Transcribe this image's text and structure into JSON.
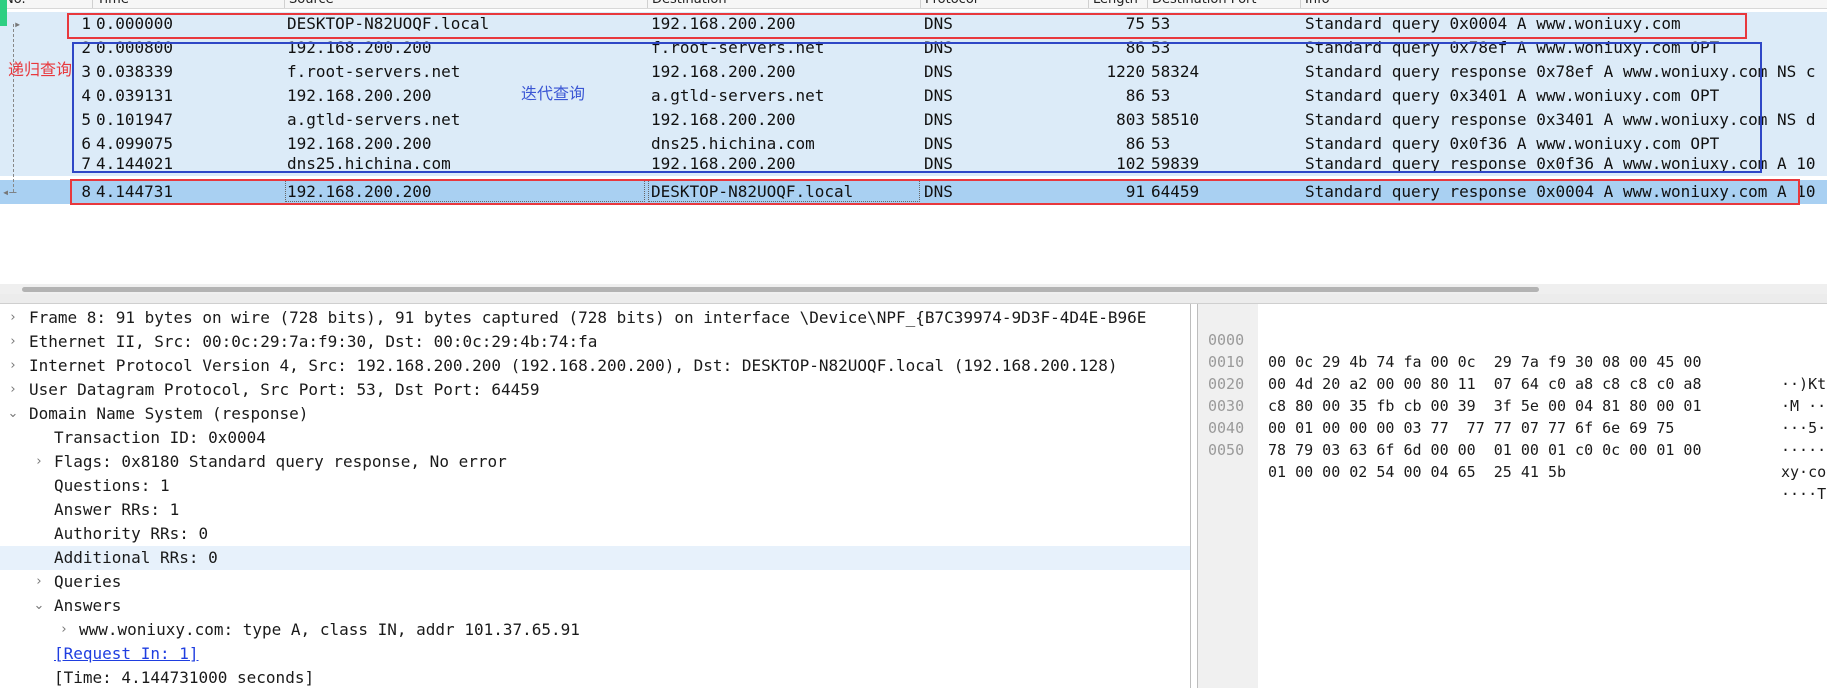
{
  "columns": {
    "no": "No.",
    "time": "Time",
    "source": "Source",
    "destination": "Destination",
    "protocol": "Protocol",
    "length": "Length",
    "dport": "Destination Port",
    "info": "Info"
  },
  "packets": [
    {
      "no": "1",
      "time": "0.000000",
      "src": "DESKTOP-N82UOQF.local",
      "dst": "192.168.200.200",
      "proto": "DNS",
      "len": "75",
      "dport": "53",
      "info": "Standard query 0x0004 A www.woniuxy.com"
    },
    {
      "no": "2",
      "time": "0.000800",
      "src": "192.168.200.200",
      "dst": "f.root-servers.net",
      "proto": "DNS",
      "len": "86",
      "dport": "53",
      "info": "Standard query 0x78ef A www.woniuxy.com OPT"
    },
    {
      "no": "3",
      "time": "0.038339",
      "src": "f.root-servers.net",
      "dst": "192.168.200.200",
      "proto": "DNS",
      "len": "1220",
      "dport": "58324",
      "info": "Standard query response 0x78ef A www.woniuxy.com NS c"
    },
    {
      "no": "4",
      "time": "0.039131",
      "src": "192.168.200.200",
      "dst": "a.gtld-servers.net",
      "proto": "DNS",
      "len": "86",
      "dport": "53",
      "info": "Standard query 0x3401 A www.woniuxy.com OPT"
    },
    {
      "no": "5",
      "time": "0.101947",
      "src": "a.gtld-servers.net",
      "dst": "192.168.200.200",
      "proto": "DNS",
      "len": "803",
      "dport": "58510",
      "info": "Standard query response 0x3401 A www.woniuxy.com NS d"
    },
    {
      "no": "6",
      "time": "4.099075",
      "src": "192.168.200.200",
      "dst": "dns25.hichina.com",
      "proto": "DNS",
      "len": "86",
      "dport": "53",
      "info": "Standard query 0x0f36 A www.woniuxy.com OPT"
    },
    {
      "no": "7",
      "time": "4.144021",
      "src": "dns25.hichina.com",
      "dst": "192.168.200.200",
      "proto": "DNS",
      "len": "102",
      "dport": "59839",
      "info": "Standard query response 0x0f36 A www.woniuxy.com A 10"
    },
    {
      "no": "8",
      "time": "4.144731",
      "src": "192.168.200.200",
      "dst": "DESKTOP-N82UOQF.local",
      "proto": "DNS",
      "len": "91",
      "dport": "64459",
      "info": "Standard query response 0x0004 A www.woniuxy.com A 10"
    }
  ],
  "annotations": {
    "recursive_label": "递归查询",
    "iterative_label": "迭代查询",
    "red_color": "#e8383d",
    "blue_color": "#2f47c6"
  },
  "details": [
    {
      "text": "Frame 8: 91 bytes on wire (728 bits), 91 bytes captured (728 bits) on interface \\Device\\NPF_{B7C39974-9D3F-4D4E-B96E",
      "twisty": "›"
    },
    {
      "text": "Ethernet II, Src: 00:0c:29:7a:f9:30, Dst: 00:0c:29:4b:74:fa",
      "twisty": "›"
    },
    {
      "text": "Internet Protocol Version 4, Src: 192.168.200.200 (192.168.200.200), Dst: DESKTOP-N82UOQF.local (192.168.200.128)",
      "twisty": "›"
    },
    {
      "text": "User Datagram Protocol, Src Port: 53, Dst Port: 64459",
      "twisty": "›"
    },
    {
      "text": "Domain Name System (response)",
      "twisty": "⌄"
    },
    {
      "text": "Transaction ID: 0x0004",
      "twisty": ""
    },
    {
      "text": "Flags: 0x8180 Standard query response, No error",
      "twisty": "›"
    },
    {
      "text": "Questions: 1",
      "twisty": ""
    },
    {
      "text": "Answer RRs: 1",
      "twisty": ""
    },
    {
      "text": "Authority RRs: 0",
      "twisty": ""
    },
    {
      "text": "Additional RRs: 0",
      "twisty": ""
    },
    {
      "text": "Queries",
      "twisty": "›"
    },
    {
      "text": "Answers",
      "twisty": "⌄"
    },
    {
      "text": "www.woniuxy.com: type A, class IN, addr 101.37.65.91",
      "twisty": "›"
    },
    {
      "text": "[Request In: 1]",
      "twisty": ""
    },
    {
      "text": "[Time: 4.144731000 seconds]",
      "twisty": ""
    }
  ],
  "bytes": [
    {
      "offset": "0000",
      "hex": "00 0c 29 4b 74 fa 00 0c  29 7a f9 30 08 00 45 00",
      "ascii": "··)Kt"
    },
    {
      "offset": "0010",
      "hex": "00 4d 20 a2 00 00 80 11  07 64 c0 a8 c8 c8 c0 a8",
      "ascii": "·M ··"
    },
    {
      "offset": "0020",
      "hex": "c8 80 00 35 fb cb 00 39  3f 5e 00 04 81 80 00 01",
      "ascii": "···5·"
    },
    {
      "offset": "0030",
      "hex": "00 01 00 00 00 03 77  77 77 07 77 6f 6e 69 75",
      "ascii": "·····"
    },
    {
      "offset": "0040",
      "hex": "78 79 03 63 6f 6d 00 00  01 00 01 c0 0c 00 01 00",
      "ascii": "xy·co"
    },
    {
      "offset": "0050",
      "hex": "01 00 00 02 54 00 04 65  25 41 5b",
      "ascii": "····T"
    }
  ]
}
